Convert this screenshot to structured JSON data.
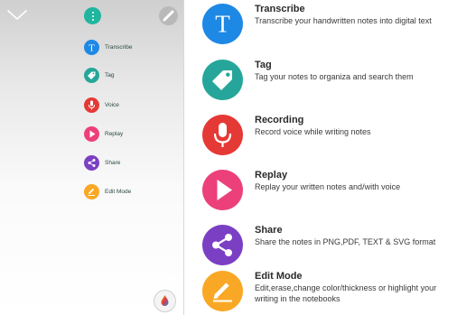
{
  "colors": {
    "transcribe": "#1e88e5",
    "tag": "#26a69a",
    "recording": "#e53935",
    "replay": "#ec407a",
    "share": "#7b3fc4",
    "edit": "#f9a825",
    "menu_button": "#1fb59e"
  },
  "phone_menu": {
    "items": [
      {
        "label": "Transcribe",
        "icon": "transcribe-icon"
      },
      {
        "label": "Tag",
        "icon": "tag-icon"
      },
      {
        "label": "Voice",
        "icon": "microphone-icon"
      },
      {
        "label": "Replay",
        "icon": "play-icon"
      },
      {
        "label": "Share",
        "icon": "share-icon"
      },
      {
        "label": "Edit Mode",
        "icon": "pencil-icon"
      }
    ]
  },
  "features": [
    {
      "title": "Transcribe",
      "description": "Transcribe your handwritten notes into digital text",
      "icon": "transcribe-icon"
    },
    {
      "title": "Tag",
      "description": "Tag your notes to organiza and search them",
      "icon": "tag-icon"
    },
    {
      "title": "Recording",
      "description": "Record voice while writing notes",
      "icon": "microphone-icon"
    },
    {
      "title": "Replay",
      "description": "Replay your written notes and/with voice",
      "icon": "play-icon"
    },
    {
      "title": "Share",
      "description": "Share the notes in PNG,PDF, TEXT & SVG format",
      "icon": "share-icon"
    },
    {
      "title": "Edit Mode",
      "description": "Edit,erase,change color/thickness or highlight your writing in the notebooks",
      "icon": "pencil-icon"
    }
  ]
}
